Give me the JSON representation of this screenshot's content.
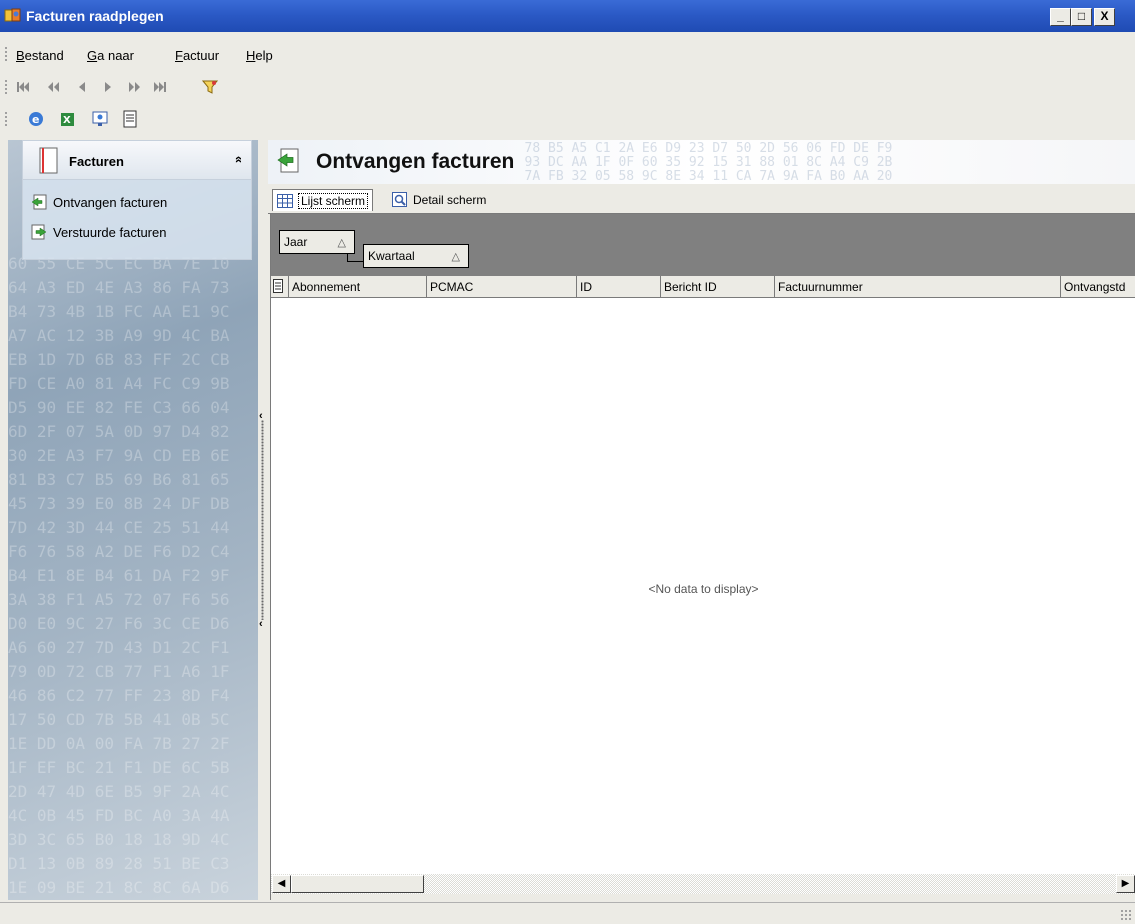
{
  "window": {
    "title": "Facturen raadplegen",
    "controls": {
      "minimize": "_",
      "maximize": "□",
      "close": "X"
    }
  },
  "menu": {
    "items": [
      {
        "label": "Bestand",
        "mnemonic": "B"
      },
      {
        "label": "Ga naar",
        "mnemonic": "G"
      },
      {
        "label": "Factuur",
        "mnemonic": "F"
      },
      {
        "label": "Help",
        "mnemonic": "H"
      }
    ]
  },
  "toolbar_nav": {
    "buttons": [
      "first-record-icon",
      "previous-page-icon",
      "previous-record-icon",
      "next-record-icon",
      "next-page-icon",
      "last-record-icon",
      "filter-icon"
    ]
  },
  "toolbar_actions": {
    "buttons": [
      "internet-explorer-icon",
      "excel-export-icon",
      "presentation-icon",
      "document-icon"
    ]
  },
  "sidebar": {
    "header": "Facturen",
    "collapse_glyph": "»",
    "items": [
      {
        "label": "Ontvangen facturen",
        "icon": "incoming-invoice-icon"
      },
      {
        "label": "Verstuurde facturen",
        "icon": "outgoing-invoice-icon"
      }
    ]
  },
  "main": {
    "title": "Ontvangen facturen",
    "tabs": [
      {
        "label": "Lijst scherm",
        "icon": "grid-icon",
        "active": true
      },
      {
        "label": "Detail scherm",
        "icon": "detail-view-icon",
        "active": false
      }
    ],
    "group_by": [
      {
        "label": "Jaar",
        "sort": "△"
      },
      {
        "label": "Kwartaal",
        "sort": "△"
      }
    ],
    "columns": [
      "Abonnement",
      "PCMAC",
      "ID",
      "Bericht ID",
      "Factuurnummer",
      "Ontvangstd"
    ],
    "empty_text": "<No data to display>"
  },
  "colors": {
    "title_bar": "#2a58c4",
    "group_panel": "#808080",
    "accent_green": "#3aa33a"
  }
}
